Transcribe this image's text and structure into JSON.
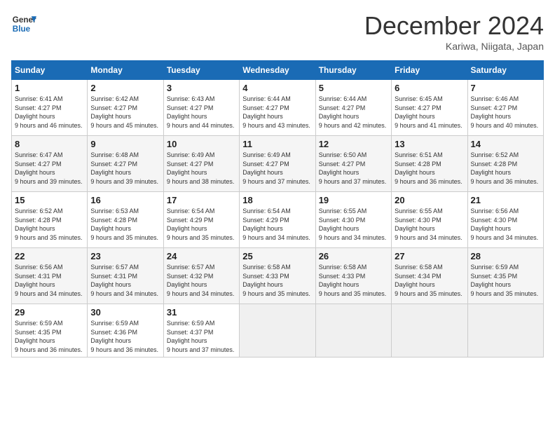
{
  "header": {
    "logo_line1": "General",
    "logo_line2": "Blue",
    "month": "December 2024",
    "location": "Kariwa, Niigata, Japan"
  },
  "weekdays": [
    "Sunday",
    "Monday",
    "Tuesday",
    "Wednesday",
    "Thursday",
    "Friday",
    "Saturday"
  ],
  "weeks": [
    [
      {
        "day": "1",
        "sr": "6:41 AM",
        "ss": "4:27 PM",
        "dl": "9 hours and 46 minutes."
      },
      {
        "day": "2",
        "sr": "6:42 AM",
        "ss": "4:27 PM",
        "dl": "9 hours and 45 minutes."
      },
      {
        "day": "3",
        "sr": "6:43 AM",
        "ss": "4:27 PM",
        "dl": "9 hours and 44 minutes."
      },
      {
        "day": "4",
        "sr": "6:44 AM",
        "ss": "4:27 PM",
        "dl": "9 hours and 43 minutes."
      },
      {
        "day": "5",
        "sr": "6:44 AM",
        "ss": "4:27 PM",
        "dl": "9 hours and 42 minutes."
      },
      {
        "day": "6",
        "sr": "6:45 AM",
        "ss": "4:27 PM",
        "dl": "9 hours and 41 minutes."
      },
      {
        "day": "7",
        "sr": "6:46 AM",
        "ss": "4:27 PM",
        "dl": "9 hours and 40 minutes."
      }
    ],
    [
      {
        "day": "8",
        "sr": "6:47 AM",
        "ss": "4:27 PM",
        "dl": "9 hours and 39 minutes."
      },
      {
        "day": "9",
        "sr": "6:48 AM",
        "ss": "4:27 PM",
        "dl": "9 hours and 39 minutes."
      },
      {
        "day": "10",
        "sr": "6:49 AM",
        "ss": "4:27 PM",
        "dl": "9 hours and 38 minutes."
      },
      {
        "day": "11",
        "sr": "6:49 AM",
        "ss": "4:27 PM",
        "dl": "9 hours and 37 minutes."
      },
      {
        "day": "12",
        "sr": "6:50 AM",
        "ss": "4:27 PM",
        "dl": "9 hours and 37 minutes."
      },
      {
        "day": "13",
        "sr": "6:51 AM",
        "ss": "4:28 PM",
        "dl": "9 hours and 36 minutes."
      },
      {
        "day": "14",
        "sr": "6:52 AM",
        "ss": "4:28 PM",
        "dl": "9 hours and 36 minutes."
      }
    ],
    [
      {
        "day": "15",
        "sr": "6:52 AM",
        "ss": "4:28 PM",
        "dl": "9 hours and 35 minutes."
      },
      {
        "day": "16",
        "sr": "6:53 AM",
        "ss": "4:28 PM",
        "dl": "9 hours and 35 minutes."
      },
      {
        "day": "17",
        "sr": "6:54 AM",
        "ss": "4:29 PM",
        "dl": "9 hours and 35 minutes."
      },
      {
        "day": "18",
        "sr": "6:54 AM",
        "ss": "4:29 PM",
        "dl": "9 hours and 34 minutes."
      },
      {
        "day": "19",
        "sr": "6:55 AM",
        "ss": "4:30 PM",
        "dl": "9 hours and 34 minutes."
      },
      {
        "day": "20",
        "sr": "6:55 AM",
        "ss": "4:30 PM",
        "dl": "9 hours and 34 minutes."
      },
      {
        "day": "21",
        "sr": "6:56 AM",
        "ss": "4:30 PM",
        "dl": "9 hours and 34 minutes."
      }
    ],
    [
      {
        "day": "22",
        "sr": "6:56 AM",
        "ss": "4:31 PM",
        "dl": "9 hours and 34 minutes."
      },
      {
        "day": "23",
        "sr": "6:57 AM",
        "ss": "4:31 PM",
        "dl": "9 hours and 34 minutes."
      },
      {
        "day": "24",
        "sr": "6:57 AM",
        "ss": "4:32 PM",
        "dl": "9 hours and 34 minutes."
      },
      {
        "day": "25",
        "sr": "6:58 AM",
        "ss": "4:33 PM",
        "dl": "9 hours and 35 minutes."
      },
      {
        "day": "26",
        "sr": "6:58 AM",
        "ss": "4:33 PM",
        "dl": "9 hours and 35 minutes."
      },
      {
        "day": "27",
        "sr": "6:58 AM",
        "ss": "4:34 PM",
        "dl": "9 hours and 35 minutes."
      },
      {
        "day": "28",
        "sr": "6:59 AM",
        "ss": "4:35 PM",
        "dl": "9 hours and 35 minutes."
      }
    ],
    [
      {
        "day": "29",
        "sr": "6:59 AM",
        "ss": "4:35 PM",
        "dl": "9 hours and 36 minutes."
      },
      {
        "day": "30",
        "sr": "6:59 AM",
        "ss": "4:36 PM",
        "dl": "9 hours and 36 minutes."
      },
      {
        "day": "31",
        "sr": "6:59 AM",
        "ss": "4:37 PM",
        "dl": "9 hours and 37 minutes."
      },
      null,
      null,
      null,
      null
    ]
  ]
}
